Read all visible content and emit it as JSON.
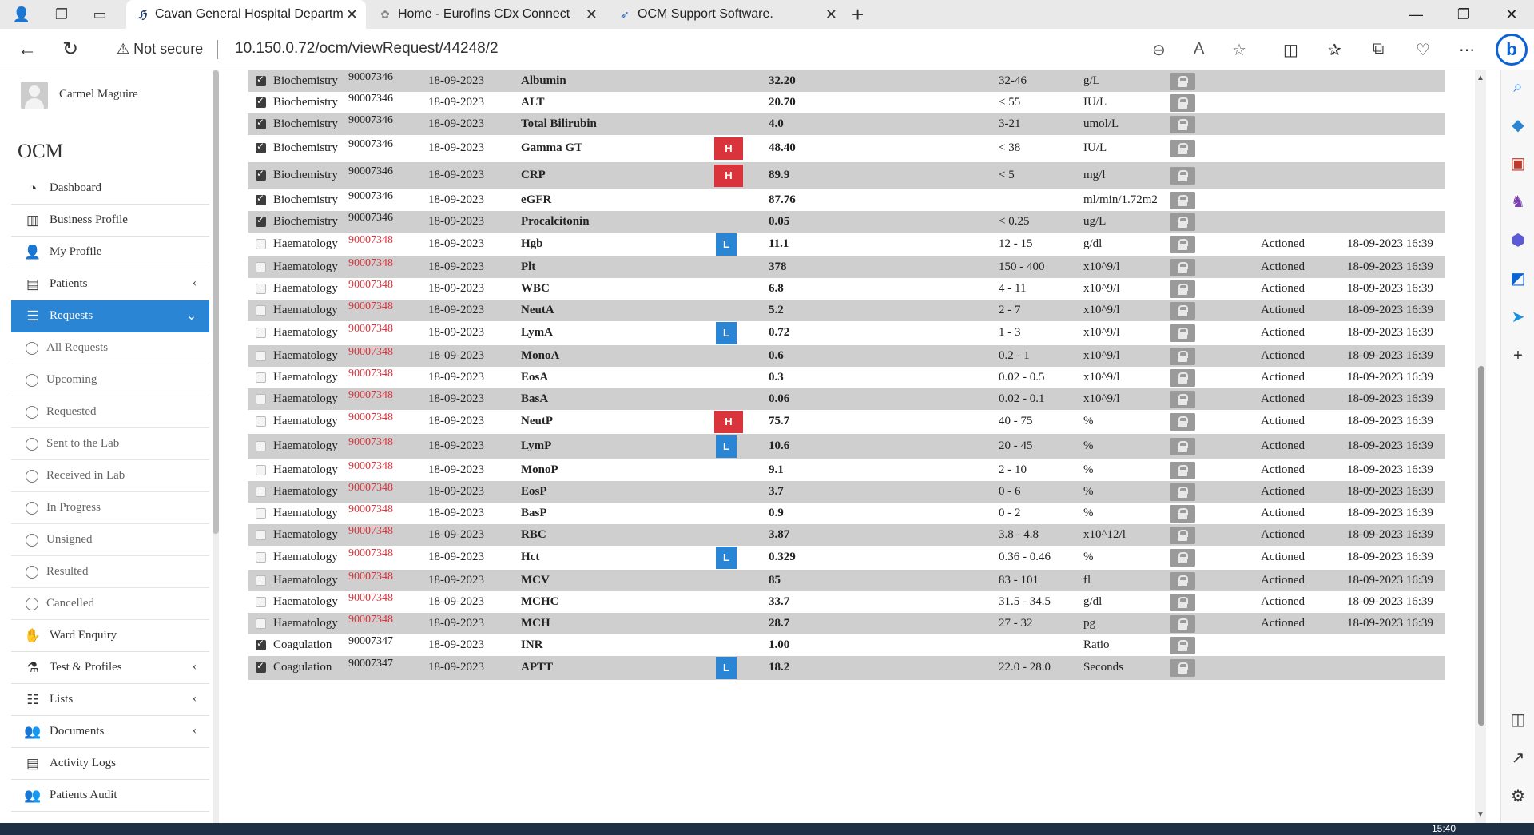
{
  "browser": {
    "tabs": [
      {
        "title": "Cavan General Hospital Departm",
        "icon": "hf-logo-icon",
        "active": true
      },
      {
        "title": "Home - Eurofins CDx Connect",
        "icon": "eurofins-icon",
        "active": false
      },
      {
        "title": "OCM Support Software.",
        "icon": "ocm-support-icon",
        "active": false
      }
    ],
    "not_secure_label": "Not secure",
    "url": "10.150.0.72/ocm/viewRequest/44248/2"
  },
  "user": {
    "name": "Carmel Maguire"
  },
  "brand": "OCM",
  "nav": {
    "dashboard": "Dashboard",
    "business_profile": "Business Profile",
    "my_profile": "My Profile",
    "patients": "Patients",
    "requests": "Requests",
    "sub": [
      "All Requests",
      "Upcoming",
      "Requested",
      "Sent to the Lab",
      "Received in Lab",
      "In Progress",
      "Unsigned",
      "Resulted",
      "Cancelled"
    ],
    "ward_enquiry": "Ward Enquiry",
    "test_profiles": "Test & Profiles",
    "lists": "Lists",
    "documents": "Documents",
    "activity_logs": "Activity Logs",
    "patients_audit": "Patients Audit"
  },
  "results": [
    {
      "checked": true,
      "dept": "Biochemistry",
      "req": "90007346",
      "red": false,
      "date": "18-09-2023",
      "test": "Albumin",
      "flag": "",
      "value": "32.20",
      "range": "32-46",
      "unit": "g/L",
      "status": "",
      "time": ""
    },
    {
      "checked": true,
      "dept": "Biochemistry",
      "req": "90007346",
      "red": false,
      "date": "18-09-2023",
      "test": "ALT",
      "flag": "",
      "value": "20.70",
      "range": "< 55",
      "unit": "IU/L",
      "status": "",
      "time": ""
    },
    {
      "checked": true,
      "dept": "Biochemistry",
      "req": "90007346",
      "red": false,
      "date": "18-09-2023",
      "test": "Total Bilirubin",
      "flag": "",
      "value": "4.0",
      "range": "3-21",
      "unit": "umol/L",
      "status": "",
      "time": ""
    },
    {
      "checked": true,
      "dept": "Biochemistry",
      "req": "90007346",
      "red": false,
      "date": "18-09-2023",
      "test": "Gamma GT",
      "flag": "H",
      "value": "48.40",
      "range": "< 38",
      "unit": "IU/L",
      "status": "",
      "time": ""
    },
    {
      "checked": true,
      "dept": "Biochemistry",
      "req": "90007346",
      "red": false,
      "date": "18-09-2023",
      "test": "CRP",
      "flag": "H",
      "value": "89.9",
      "range": "< 5",
      "unit": "mg/l",
      "status": "",
      "time": ""
    },
    {
      "checked": true,
      "dept": "Biochemistry",
      "req": "90007346",
      "red": false,
      "date": "18-09-2023",
      "test": "eGFR",
      "flag": "",
      "value": "87.76",
      "range": "",
      "unit": "ml/min/1.72m2",
      "status": "",
      "time": ""
    },
    {
      "checked": true,
      "dept": "Biochemistry",
      "req": "90007346",
      "red": false,
      "date": "18-09-2023",
      "test": "Procalcitonin",
      "flag": "",
      "value": "0.05",
      "range": "< 0.25",
      "unit": "ug/L",
      "status": "",
      "time": ""
    },
    {
      "checked": false,
      "dept": "Haematology",
      "req": "90007348",
      "red": true,
      "date": "18-09-2023",
      "test": "Hgb",
      "flag": "L",
      "value": "11.1",
      "range": "12 - 15",
      "unit": "g/dl",
      "status": "Actioned",
      "time": "18-09-2023 16:39"
    },
    {
      "checked": false,
      "dept": "Haematology",
      "req": "90007348",
      "red": true,
      "date": "18-09-2023",
      "test": "Plt",
      "flag": "",
      "value": "378",
      "range": "150 - 400",
      "unit": "x10^9/l",
      "status": "Actioned",
      "time": "18-09-2023 16:39"
    },
    {
      "checked": false,
      "dept": "Haematology",
      "req": "90007348",
      "red": true,
      "date": "18-09-2023",
      "test": "WBC",
      "flag": "",
      "value": "6.8",
      "range": "4 - 11",
      "unit": "x10^9/l",
      "status": "Actioned",
      "time": "18-09-2023 16:39"
    },
    {
      "checked": false,
      "dept": "Haematology",
      "req": "90007348",
      "red": true,
      "date": "18-09-2023",
      "test": "NeutA",
      "flag": "",
      "value": "5.2",
      "range": "2 - 7",
      "unit": "x10^9/l",
      "status": "Actioned",
      "time": "18-09-2023 16:39"
    },
    {
      "checked": false,
      "dept": "Haematology",
      "req": "90007348",
      "red": true,
      "date": "18-09-2023",
      "test": "LymA",
      "flag": "L",
      "value": "0.72",
      "range": "1 - 3",
      "unit": "x10^9/l",
      "status": "Actioned",
      "time": "18-09-2023 16:39"
    },
    {
      "checked": false,
      "dept": "Haematology",
      "req": "90007348",
      "red": true,
      "date": "18-09-2023",
      "test": "MonoA",
      "flag": "",
      "value": "0.6",
      "range": "0.2 - 1",
      "unit": "x10^9/l",
      "status": "Actioned",
      "time": "18-09-2023 16:39"
    },
    {
      "checked": false,
      "dept": "Haematology",
      "req": "90007348",
      "red": true,
      "date": "18-09-2023",
      "test": "EosA",
      "flag": "",
      "value": "0.3",
      "range": "0.02 - 0.5",
      "unit": "x10^9/l",
      "status": "Actioned",
      "time": "18-09-2023 16:39"
    },
    {
      "checked": false,
      "dept": "Haematology",
      "req": "90007348",
      "red": true,
      "date": "18-09-2023",
      "test": "BasA",
      "flag": "",
      "value": "0.06",
      "range": "0.02 - 0.1",
      "unit": "x10^9/l",
      "status": "Actioned",
      "time": "18-09-2023 16:39"
    },
    {
      "checked": false,
      "dept": "Haematology",
      "req": "90007348",
      "red": true,
      "date": "18-09-2023",
      "test": "NeutP",
      "flag": "H",
      "value": "75.7",
      "range": "40 - 75",
      "unit": "%",
      "status": "Actioned",
      "time": "18-09-2023 16:39"
    },
    {
      "checked": false,
      "dept": "Haematology",
      "req": "90007348",
      "red": true,
      "date": "18-09-2023",
      "test": "LymP",
      "flag": "L",
      "value": "10.6",
      "range": "20 - 45",
      "unit": "%",
      "status": "Actioned",
      "time": "18-09-2023 16:39"
    },
    {
      "checked": false,
      "dept": "Haematology",
      "req": "90007348",
      "red": true,
      "date": "18-09-2023",
      "test": "MonoP",
      "flag": "",
      "value": "9.1",
      "range": "2 - 10",
      "unit": "%",
      "status": "Actioned",
      "time": "18-09-2023 16:39"
    },
    {
      "checked": false,
      "dept": "Haematology",
      "req": "90007348",
      "red": true,
      "date": "18-09-2023",
      "test": "EosP",
      "flag": "",
      "value": "3.7",
      "range": "0 - 6",
      "unit": "%",
      "status": "Actioned",
      "time": "18-09-2023 16:39"
    },
    {
      "checked": false,
      "dept": "Haematology",
      "req": "90007348",
      "red": true,
      "date": "18-09-2023",
      "test": "BasP",
      "flag": "",
      "value": "0.9",
      "range": "0 - 2",
      "unit": "%",
      "status": "Actioned",
      "time": "18-09-2023 16:39"
    },
    {
      "checked": false,
      "dept": "Haematology",
      "req": "90007348",
      "red": true,
      "date": "18-09-2023",
      "test": "RBC",
      "flag": "",
      "value": "3.87",
      "range": "3.8 - 4.8",
      "unit": "x10^12/l",
      "status": "Actioned",
      "time": "18-09-2023 16:39"
    },
    {
      "checked": false,
      "dept": "Haematology",
      "req": "90007348",
      "red": true,
      "date": "18-09-2023",
      "test": "Hct",
      "flag": "L",
      "value": "0.329",
      "range": "0.36 - 0.46",
      "unit": "%",
      "status": "Actioned",
      "time": "18-09-2023 16:39"
    },
    {
      "checked": false,
      "dept": "Haematology",
      "req": "90007348",
      "red": true,
      "date": "18-09-2023",
      "test": "MCV",
      "flag": "",
      "value": "85",
      "range": "83 - 101",
      "unit": "fl",
      "status": "Actioned",
      "time": "18-09-2023 16:39"
    },
    {
      "checked": false,
      "dept": "Haematology",
      "req": "90007348",
      "red": true,
      "date": "18-09-2023",
      "test": "MCHC",
      "flag": "",
      "value": "33.7",
      "range": "31.5 - 34.5",
      "unit": "g/dl",
      "status": "Actioned",
      "time": "18-09-2023 16:39"
    },
    {
      "checked": false,
      "dept": "Haematology",
      "req": "90007348",
      "red": true,
      "date": "18-09-2023",
      "test": "MCH",
      "flag": "",
      "value": "28.7",
      "range": "27 - 32",
      "unit": "pg",
      "status": "Actioned",
      "time": "18-09-2023 16:39"
    },
    {
      "checked": true,
      "dept": "Coagulation",
      "req": "90007347",
      "red": false,
      "date": "18-09-2023",
      "test": "INR",
      "flag": "",
      "value": "1.00",
      "range": "",
      "unit": "Ratio",
      "status": "",
      "time": ""
    },
    {
      "checked": true,
      "dept": "Coagulation",
      "req": "90007347",
      "red": false,
      "date": "18-09-2023",
      "test": "APTT",
      "flag": "L",
      "value": "18.2",
      "range": "22.0 - 28.0",
      "unit": "Seconds",
      "status": "",
      "time": ""
    }
  ],
  "taskbar": {
    "clock": "15:40"
  }
}
